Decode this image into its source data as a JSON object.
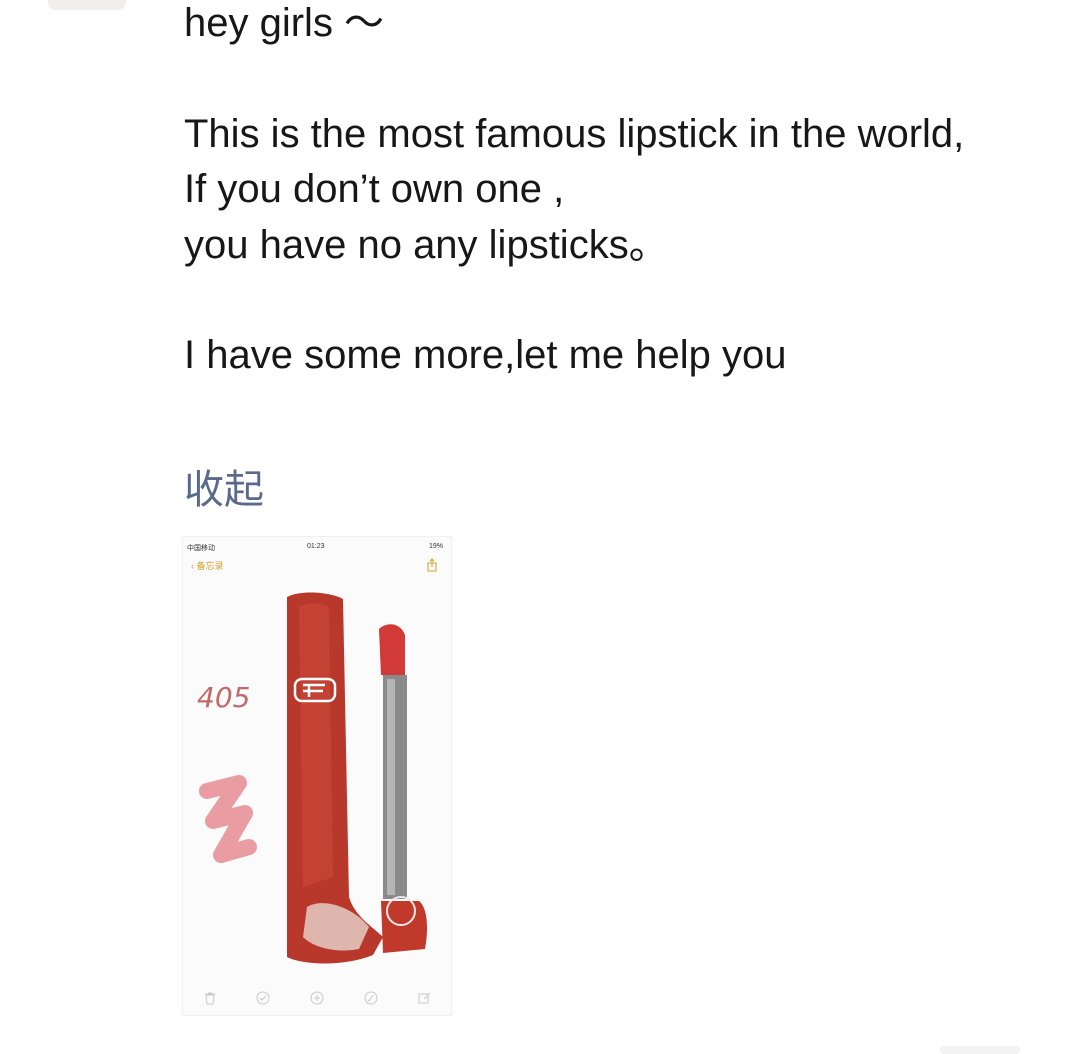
{
  "post": {
    "greeting": "hey girls ～",
    "line1": "This is the most famous lipstick in the world,",
    "line2": "If you don’t own one ,",
    "line3": "you have no any lipsticks。",
    "line4": "I have some more,let me help you",
    "collapse_label": "收起"
  },
  "screenshot": {
    "carrier": "中国移动",
    "time": "01:23",
    "battery": "19%",
    "back_label": "备忘录",
    "drawn_shade": "405",
    "icons": [
      "trash-icon",
      "check-circle-icon",
      "plus-circle-icon",
      "pen-circle-icon",
      "compose-icon"
    ]
  },
  "colors": {
    "text": "#171717",
    "link": "#5b6a8c",
    "lipstick_red": "#c0392b",
    "notes_yellow": "#d7a12c"
  }
}
